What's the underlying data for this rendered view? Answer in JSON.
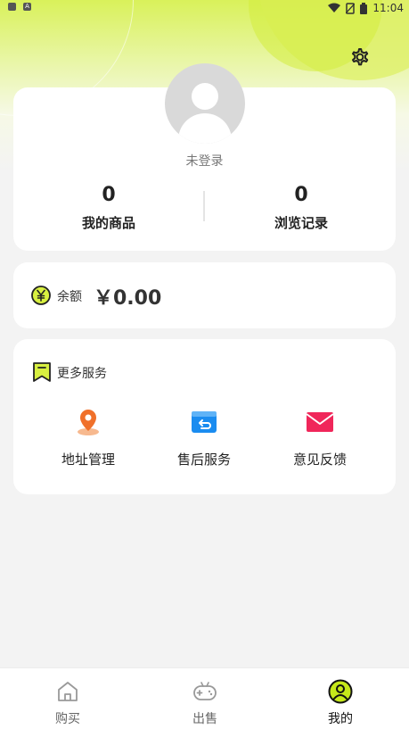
{
  "status_bar": {
    "time": "11:04"
  },
  "profile": {
    "login_text": "未登录",
    "stats": [
      {
        "value": "0",
        "label": "我的商品"
      },
      {
        "value": "0",
        "label": "浏览记录"
      }
    ]
  },
  "balance": {
    "label": "余额",
    "amount": "￥0.00"
  },
  "services": {
    "title": "更多服务",
    "items": [
      {
        "label": "地址管理",
        "icon": "location-pin-icon",
        "color": "#f0702a"
      },
      {
        "label": "售后服务",
        "icon": "return-box-icon",
        "color": "#1a8cf0"
      },
      {
        "label": "意见反馈",
        "icon": "mail-icon",
        "color": "#f0265a"
      }
    ]
  },
  "tabbar": {
    "items": [
      {
        "label": "购买",
        "icon": "home-icon",
        "active": false
      },
      {
        "label": "出售",
        "icon": "gamepad-icon",
        "active": false
      },
      {
        "label": "我的",
        "icon": "user-icon",
        "active": true
      }
    ]
  },
  "colors": {
    "accent": "#d9f15a",
    "active_icon": "#c6e81a"
  }
}
